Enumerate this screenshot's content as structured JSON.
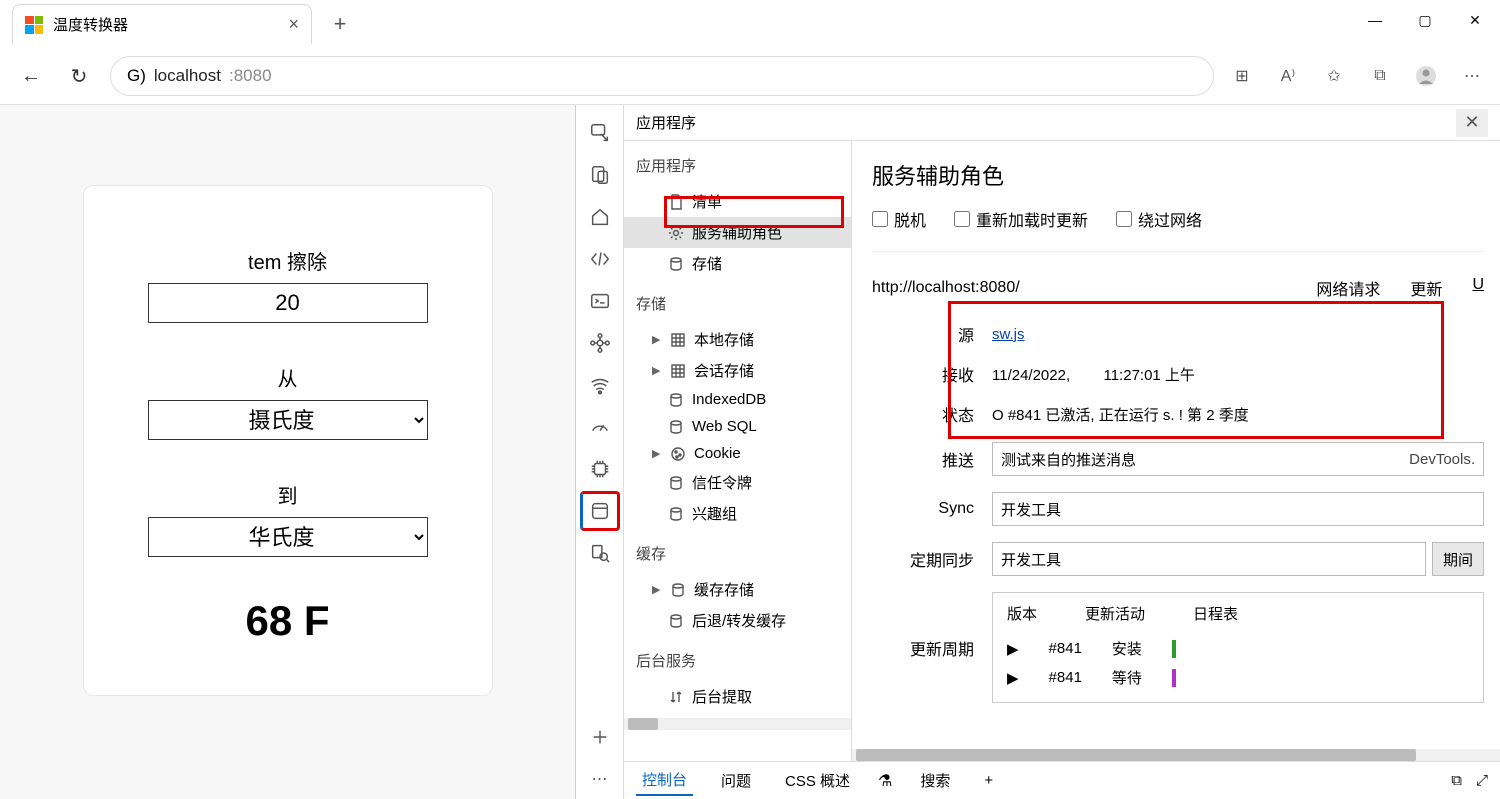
{
  "browser": {
    "tab_title": "温度转换器",
    "url_prefix": "G)",
    "url_host": "localhost",
    "url_port": ":8080"
  },
  "win_controls": {
    "min": "—",
    "max": "▢",
    "close": "✕"
  },
  "page": {
    "tem_label": "tem 擦除",
    "tem_value": "20",
    "from_label": "从",
    "from_value": "摄氏度",
    "to_label": "到",
    "to_value": "华氏度",
    "result": "68 F"
  },
  "devtools": {
    "header_title": "应用程序",
    "tree": {
      "app_section": "应用程序",
      "items_app": [
        "清单",
        "服务辅助角色",
        "存储"
      ],
      "storage_section": "存储",
      "items_storage": [
        "本地存储",
        "会话存储",
        "IndexedDB",
        "Web SQL",
        "Cookie",
        "信任令牌",
        "兴趣组"
      ],
      "cache_section": "缓存",
      "items_cache": [
        "缓存存储",
        "后退/转发缓存"
      ],
      "bg_section": "后台服务",
      "items_bg": [
        "后台提取"
      ]
    },
    "sw": {
      "title": "服务辅助角色",
      "checks": [
        "脱机",
        "重新加载时更新",
        "绕过网络"
      ],
      "origin": "http://localhost:8080/",
      "links": [
        "网络请求",
        "更新",
        "U"
      ],
      "rows": {
        "source_lbl": "源",
        "source_val": "sw.js",
        "recv_lbl": "接收",
        "recv_date": "11/24/2022,",
        "recv_time": "11:27:01 上午",
        "status_lbl": "状态",
        "status_val": "O #841 已激活, 正在运行 s. ! 第 2 季度",
        "push_lbl": "推送",
        "push_placeholder": "测试来自的推送消息",
        "push_right": "DevTools.",
        "sync_lbl": "Sync",
        "sync_val": "开发工具",
        "periodic_lbl": "定期同步",
        "periodic_val": "开发工具",
        "period_btn": "期间",
        "cycle_lbl": "更新周期",
        "cycle_headers": [
          "版本",
          "更新活动",
          "日程表"
        ],
        "cycle_rows": [
          {
            "ver": "#841",
            "act": "安装",
            "color": "g"
          },
          {
            "ver": "#841",
            "act": "等待",
            "color": "p"
          }
        ]
      }
    },
    "footer": {
      "tabs": [
        "控制台",
        "问题",
        "CSS 概述"
      ],
      "search": "搜索",
      "plus": "+"
    }
  }
}
